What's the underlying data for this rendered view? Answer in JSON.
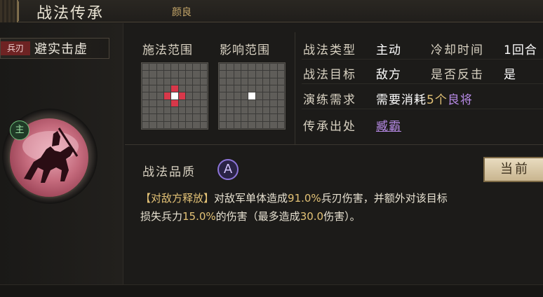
{
  "header": {
    "title": "战法传承",
    "general_name": "颜良"
  },
  "skill": {
    "tag": "兵刃",
    "name": "避实击虚",
    "main_badge": "主"
  },
  "range": {
    "cast_label": "施法范围",
    "effect_label": "影响范围"
  },
  "info": {
    "type_label": "战法类型",
    "type_value": "主动",
    "cooldown_label": "冷却时间",
    "cooldown_value": "1回合",
    "target_label": "战法目标",
    "target_value": "敌方",
    "counter_label": "是否反击",
    "counter_value": "是",
    "train_label": "演练需求",
    "train_prefix": "需要消耗",
    "train_count": "5个",
    "train_item": "良将",
    "source_label": "传承出处",
    "source_value": "臧霸"
  },
  "grade": {
    "label": "战法品质",
    "value": "A"
  },
  "button": {
    "current": "当前"
  },
  "description": {
    "tag": "【对敌方释放】",
    "part1": "对敌军单体造成",
    "num1": "91.0%",
    "part2": "兵刃伤害，并额外对该目标",
    "part3": "损失兵力",
    "num2": "15.0%",
    "part4": "的伤害（最多造成",
    "num3": "30.0",
    "part5": "伤害）。"
  },
  "colors": {
    "cast_cells": "#d8384a",
    "center_cell": "#ffffff",
    "highlight_number": "#e3c276",
    "link_purple": "#b78ae6"
  }
}
